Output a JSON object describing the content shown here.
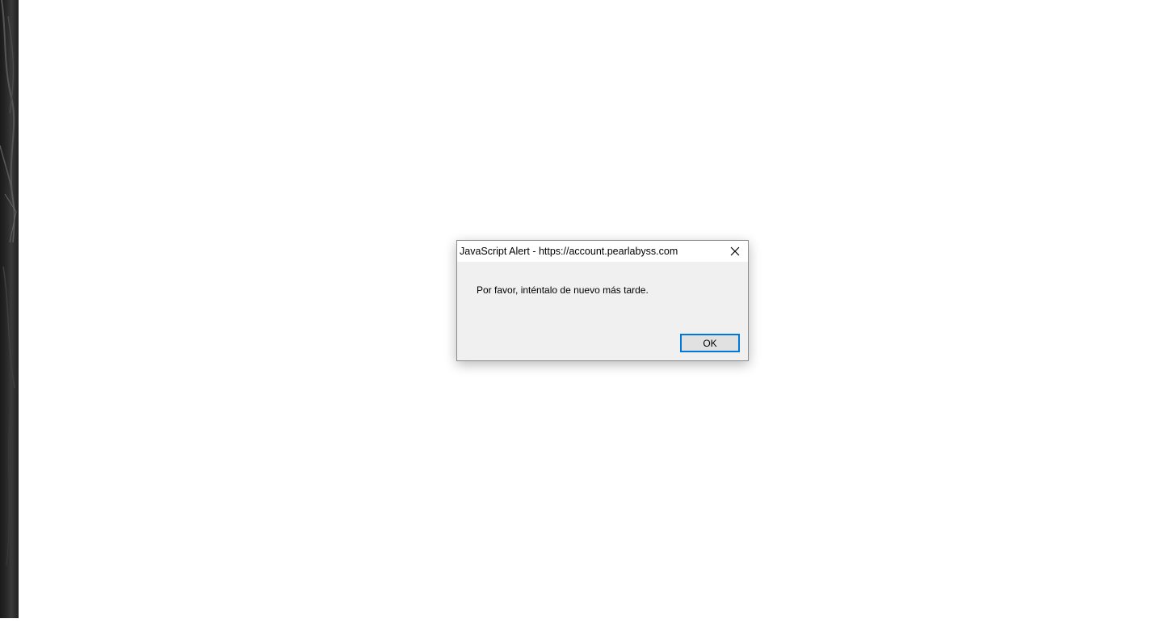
{
  "dialog": {
    "title": "JavaScript Alert - https://account.pearlabyss.com",
    "message": "Por favor, inténtalo de nuevo más tarde.",
    "ok_label": "OK",
    "close_icon": "close-icon"
  },
  "colors": {
    "dialog_bg": "#f0f0f0",
    "titlebar_bg": "#ffffff",
    "button_bg": "#e1e1e1",
    "button_focus_border": "#0078d7",
    "page_bg": "#ffffff",
    "left_strip": "#2b2b2b"
  }
}
